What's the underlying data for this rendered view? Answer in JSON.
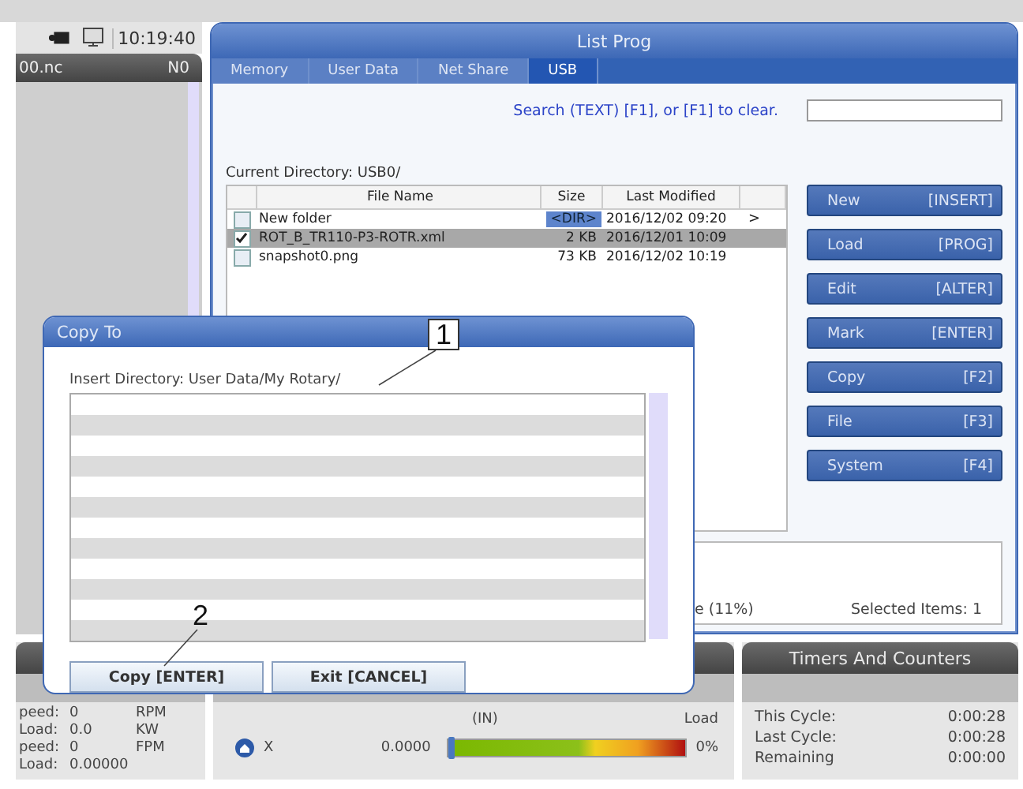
{
  "status_bar": {
    "time": "10:19:40"
  },
  "program_panel": {
    "file": "00.nc",
    "line": "N0"
  },
  "window": {
    "title": "List Prog"
  },
  "tabs": [
    {
      "label": "Memory",
      "selected": false
    },
    {
      "label": "User Data",
      "selected": false
    },
    {
      "label": "Net Share",
      "selected": false
    },
    {
      "label": "USB",
      "selected": true
    }
  ],
  "search_hint": "Search (TEXT) [F1], or [F1] to clear.",
  "current_directory": "Current Directory: USB0/",
  "table": {
    "columns": [
      "File Name",
      "Size",
      "Last Modified"
    ],
    "rows": [
      {
        "checked": false,
        "selected": false,
        "kind": "folder",
        "name": "New folder",
        "size": "<DIR>",
        "modified": "2016/12/02 09:20",
        "arrow": ">"
      },
      {
        "checked": true,
        "selected": true,
        "kind": "file",
        "name": "ROT_B_TR110-P3-ROTR.xml",
        "size": "2 KB",
        "modified": "2016/12/01 10:09"
      },
      {
        "checked": false,
        "selected": false,
        "kind": "file",
        "name": "snapshot0.png",
        "size": "73 KB",
        "modified": "2016/12/02 10:19"
      }
    ]
  },
  "buttons": [
    {
      "label": "New",
      "key": "[INSERT]"
    },
    {
      "label": "Load",
      "key": "[PROG]"
    },
    {
      "label": "Edit",
      "key": "[ALTER]"
    },
    {
      "label": "Mark",
      "key": "[ENTER]"
    },
    {
      "label": "Copy",
      "key": "[F2]"
    },
    {
      "label": "File",
      "key": "[F3]"
    },
    {
      "label": "System",
      "key": "[F4]"
    }
  ],
  "status": {
    "progress": "e (11%)",
    "selected_items": "Selected Items: 1"
  },
  "dialog": {
    "title": "Copy To",
    "directory": "Insert Directory: User Data/My Rotary/",
    "buttons": [
      "Copy [ENTER]",
      "Exit [CANCEL]"
    ]
  },
  "callouts": [
    {
      "label": "1"
    },
    {
      "label": "2"
    }
  ],
  "spindle": [
    {
      "label": "peed:",
      "value": "0",
      "unit": "RPM"
    },
    {
      "label": "Load:",
      "value": "0.0",
      "unit": "KW"
    },
    {
      "label": "peed:",
      "value": "0",
      "unit": "FPM"
    },
    {
      "label": "Load:",
      "value": "0.00000"
    }
  ],
  "position": {
    "unit": "(IN)",
    "load_heading": "Load",
    "axes": [
      {
        "axis": "X",
        "value": "0.0000",
        "level": 0,
        "load": "0%"
      }
    ]
  },
  "timers": {
    "title": "Timers And Counters",
    "rows": [
      {
        "label": "This Cycle:",
        "value": "0:00:28"
      },
      {
        "label": "Last Cycle:",
        "value": "0:00:28"
      },
      {
        "label": "Remaining",
        "value": "0:00:00"
      }
    ]
  }
}
